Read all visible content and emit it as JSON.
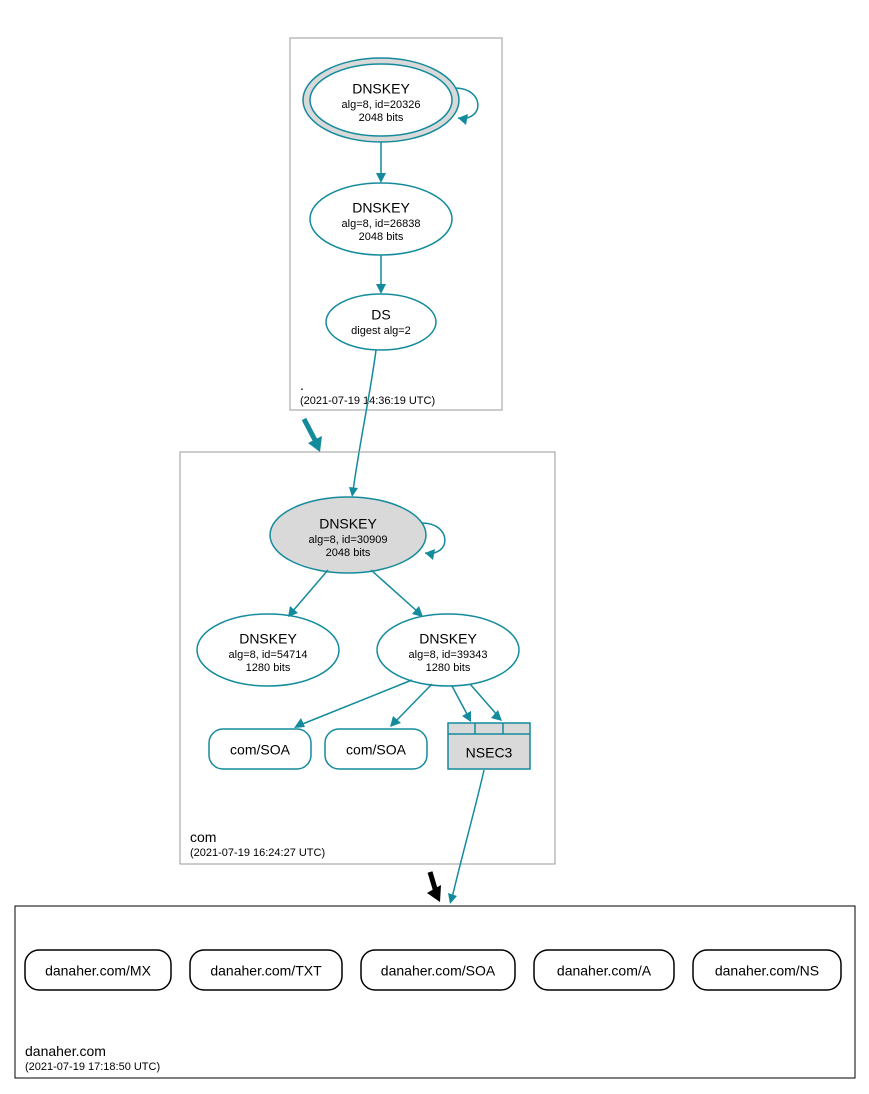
{
  "zones": {
    "root": {
      "name": ".",
      "timestamp": "(2021-07-19 14:36:19 UTC)"
    },
    "com": {
      "name": "com",
      "timestamp": "(2021-07-19 16:24:27 UTC)"
    },
    "domain": {
      "name": "danaher.com",
      "timestamp": "(2021-07-19 17:18:50 UTC)"
    }
  },
  "root": {
    "ksk": {
      "title": "DNSKEY",
      "line2": "alg=8, id=20326",
      "line3": "2048 bits"
    },
    "zsk": {
      "title": "DNSKEY",
      "line2": "alg=8, id=26838",
      "line3": "2048 bits"
    },
    "ds": {
      "title": "DS",
      "line2": "digest alg=2"
    }
  },
  "com": {
    "ksk": {
      "title": "DNSKEY",
      "line2": "alg=8, id=30909",
      "line3": "2048 bits"
    },
    "zsk1": {
      "title": "DNSKEY",
      "line2": "alg=8, id=54714",
      "line3": "1280 bits"
    },
    "zsk2": {
      "title": "DNSKEY",
      "line2": "alg=8, id=39343",
      "line3": "1280 bits"
    },
    "soa1": "com/SOA",
    "soa2": "com/SOA",
    "nsec3": "NSEC3"
  },
  "rrsets": {
    "mx": "danaher.com/MX",
    "txt": "danaher.com/TXT",
    "soa": "danaher.com/SOA",
    "a": "danaher.com/A",
    "ns": "danaher.com/NS"
  }
}
